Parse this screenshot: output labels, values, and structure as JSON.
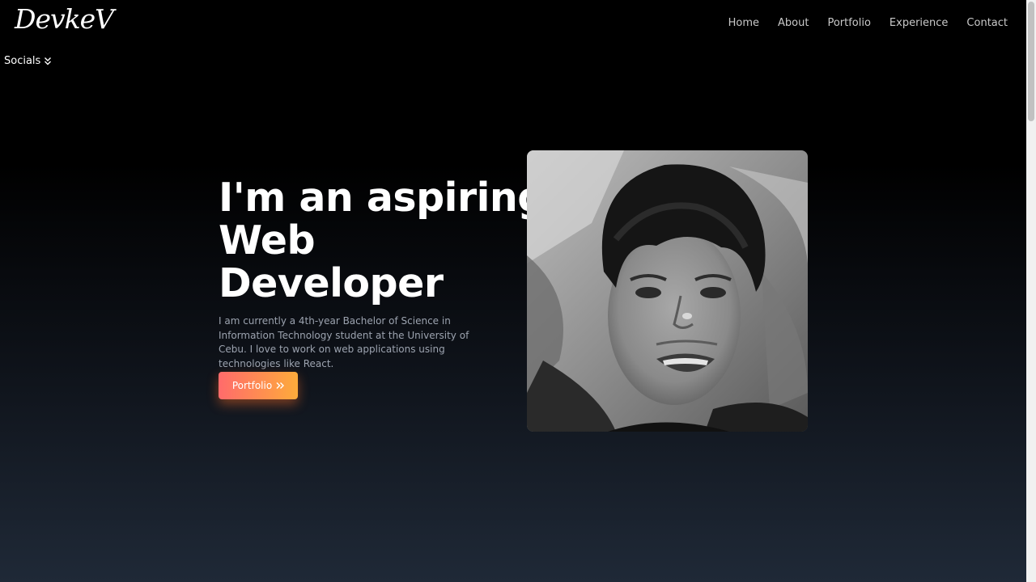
{
  "header": {
    "logo": "DevkeV",
    "nav": {
      "home": "Home",
      "about": "About",
      "portfolio": "Portfolio",
      "experience": "Experience",
      "contact": "Contact"
    }
  },
  "socials": {
    "label": "Socials",
    "icon": "double-chevron-down-icon"
  },
  "hero": {
    "title_line1": "I'm an aspiring",
    "title_line2": "Web",
    "title_line3": "Developer",
    "description": "I am currently a 4th-year Bachelor of Science in Information Technology student at the University of Cebu. I love to work on web applications using technologies like React.",
    "button_label": "Portfolio",
    "button_icon": "double-chevron-right-icon",
    "photo": "profile-photo"
  },
  "colors": {
    "background_top": "#000000",
    "background_bottom": "#1f2937",
    "button_gradient_start": "#ff6b6b",
    "button_gradient_end": "#fdab3b",
    "nav_text": "#c9c9c9",
    "description_text": "#9ca3af"
  }
}
